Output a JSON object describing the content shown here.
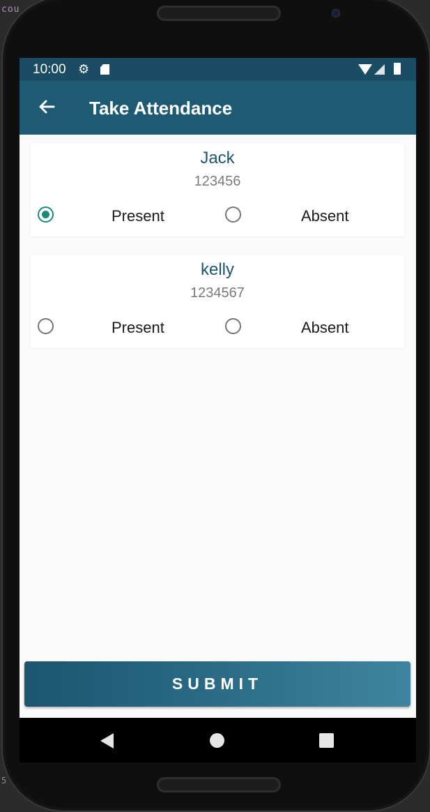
{
  "ide": {
    "snippet_top": "cou",
    "snippet_bottom": "5"
  },
  "status_bar": {
    "time": "10:00",
    "icons": [
      "gear-icon",
      "sd-card-icon",
      "wifi-icon",
      "signal-icon",
      "battery-icon"
    ]
  },
  "app_bar": {
    "title": "Take Attendance",
    "back_icon": "arrow-left-icon"
  },
  "students": [
    {
      "name": "Jack",
      "id": "123456",
      "selected": "Present",
      "options": [
        "Present",
        "Absent"
      ]
    },
    {
      "name": "kelly",
      "id": "1234567",
      "selected": null,
      "options": [
        "Present",
        "Absent"
      ]
    }
  ],
  "submit_label": "SUBMIT",
  "nav_bar": {
    "icons": [
      "back-triangle-icon",
      "home-circle-icon",
      "recents-square-icon"
    ]
  },
  "colors": {
    "app_bar": "#1f5a73",
    "status_bar": "#1a4c63",
    "radio_checked": "#1a8a7a",
    "student_name": "#1f5470"
  }
}
